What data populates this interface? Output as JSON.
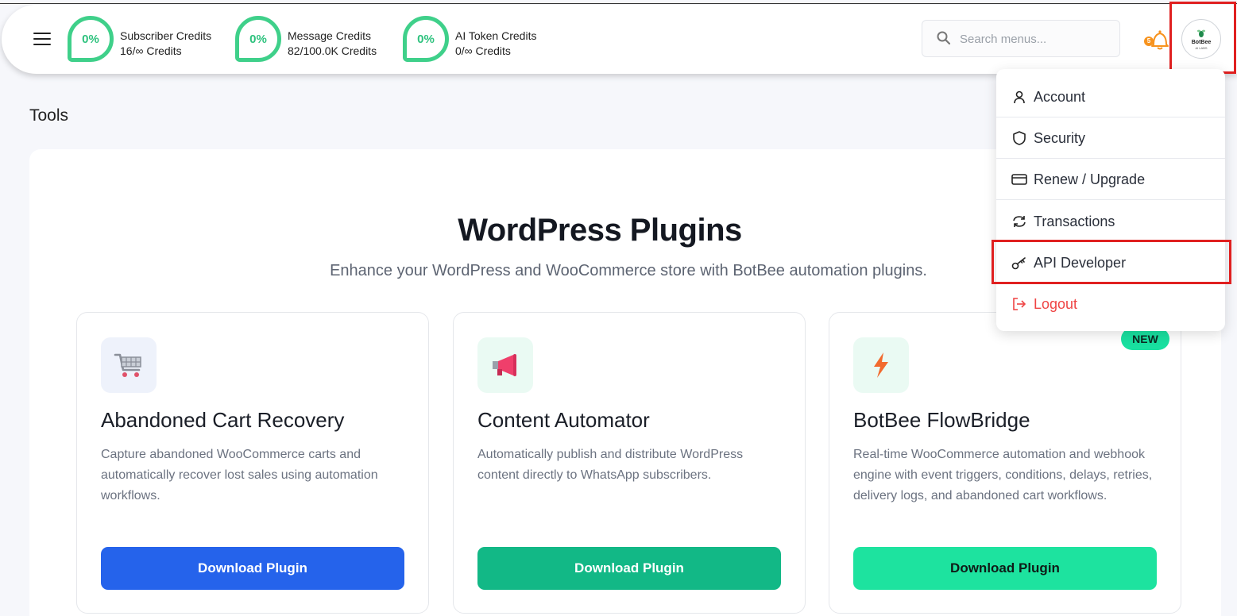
{
  "header": {
    "credits": [
      {
        "percent": "0%",
        "label": "Subscriber Credits",
        "value": "16/∞ Credits"
      },
      {
        "percent": "0%",
        "label": "Message Credits",
        "value": "82/100.0K Credits"
      },
      {
        "percent": "0%",
        "label": "AI Token Credits",
        "value": "0/∞ Credits"
      }
    ],
    "search_placeholder": "Search menus...",
    "notification_count": "5",
    "avatar_title": "BotBee",
    "avatar_sub": "AI LABS"
  },
  "page": {
    "title": "Tools"
  },
  "hero": {
    "title": "WordPress Plugins",
    "subtitle": "Enhance your WordPress and WooCommerce store with BotBee automation plugins."
  },
  "cards": [
    {
      "title": "Abandoned Cart Recovery",
      "description": "Capture abandoned WooCommerce carts and automatically recover lost sales using automation workflows.",
      "button": "Download Plugin",
      "icon": "cart-icon",
      "button_color": "#2563eb"
    },
    {
      "title": "Content Automator",
      "description": "Automatically publish and distribute WordPress content directly to WhatsApp subscribers.",
      "button": "Download Plugin",
      "icon": "megaphone-icon",
      "button_color": "#12b886"
    },
    {
      "title": "BotBee FlowBridge",
      "description": "Real-time WooCommerce automation and webhook engine with event triggers, conditions, delays, retries, delivery logs, and abandoned cart workflows.",
      "button": "Download Plugin",
      "badge": "NEW",
      "icon": "lightning-icon",
      "button_color": "#1de39f"
    }
  ],
  "user_menu": {
    "items": [
      {
        "label": "Account",
        "icon": "user-icon"
      },
      {
        "label": "Security",
        "icon": "shield-icon"
      },
      {
        "label": "Renew / Upgrade",
        "icon": "credit-card-icon"
      },
      {
        "label": "Transactions",
        "icon": "refresh-icon"
      },
      {
        "label": "API Developer",
        "icon": "key-icon"
      },
      {
        "label": "Logout",
        "icon": "logout-icon"
      }
    ]
  },
  "colors": {
    "accent_green": "#3fd08a",
    "highlight_red": "#e02020",
    "logout_red": "#ef4444"
  }
}
